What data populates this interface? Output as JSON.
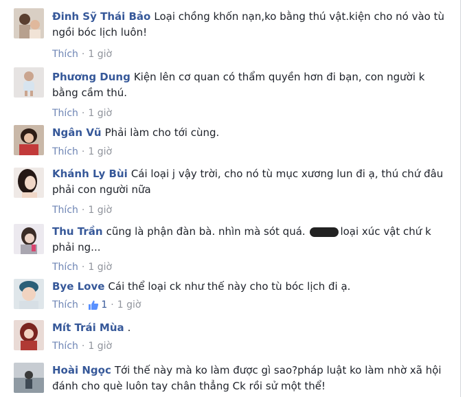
{
  "comments": [
    {
      "author": "Đinh Sỹ Thái Bảo",
      "text": "Loại chồng khốn nạn,ko bằng thú vật.kiện cho nó vào tù ngồi bóc lịch luôn!",
      "like_label": "Thích",
      "time": "1 giờ",
      "avatar_color": "#b7a08e"
    },
    {
      "author": "Phương Dung",
      "text": "Kiện lên cơ quan có thẩm quyền hơn đi bạn, con người k bằng cầm thú.",
      "like_label": "Thích",
      "time": "1 giờ",
      "avatar_color": "#c8c0bd"
    },
    {
      "author": "Ngân Vũ",
      "text": "Phải làm cho tới cùng.",
      "like_label": "Thích",
      "time": "1 giờ",
      "avatar_color": "#6b4b3e"
    },
    {
      "author": "Khánh Ly Bùi",
      "text": "Cái loại j vậy trời, cho nó tù mục xương lun đi ạ, thú chứ đâu phải con người nữa",
      "like_label": "Thích",
      "time": "1 giờ",
      "avatar_color": "#3b2a24"
    },
    {
      "author": "Thu Trần",
      "text_before": "cũng là phận đàn bà. nhìn mà sót quá.",
      "text_after": "loại xúc vật chứ k phải ng...",
      "like_label": "Thích",
      "time": "1 giờ",
      "avatar_color": "#a9a6b0"
    },
    {
      "author": "Bye Love",
      "text": "Cái thể loại ck như thế này cho tù bóc lịch đi ạ.",
      "like_label": "Thích",
      "like_count": "1",
      "time": "1 giờ",
      "avatar_color": "#5b8fa8"
    },
    {
      "author": "Mít Trái Mùa",
      "text": ".",
      "like_label": "Thích",
      "time": "1 giờ",
      "avatar_color": "#8a2d2a"
    },
    {
      "author": "Hoài Ngọc",
      "text": "Tới thế này mà ko làm được gì sao?pháp luật ko làm nhờ xã hội đánh cho què luôn tay chân thẳng Ck rồi sử một thể!",
      "avatar_color": "#7d8c9a"
    }
  ],
  "separator": "·"
}
